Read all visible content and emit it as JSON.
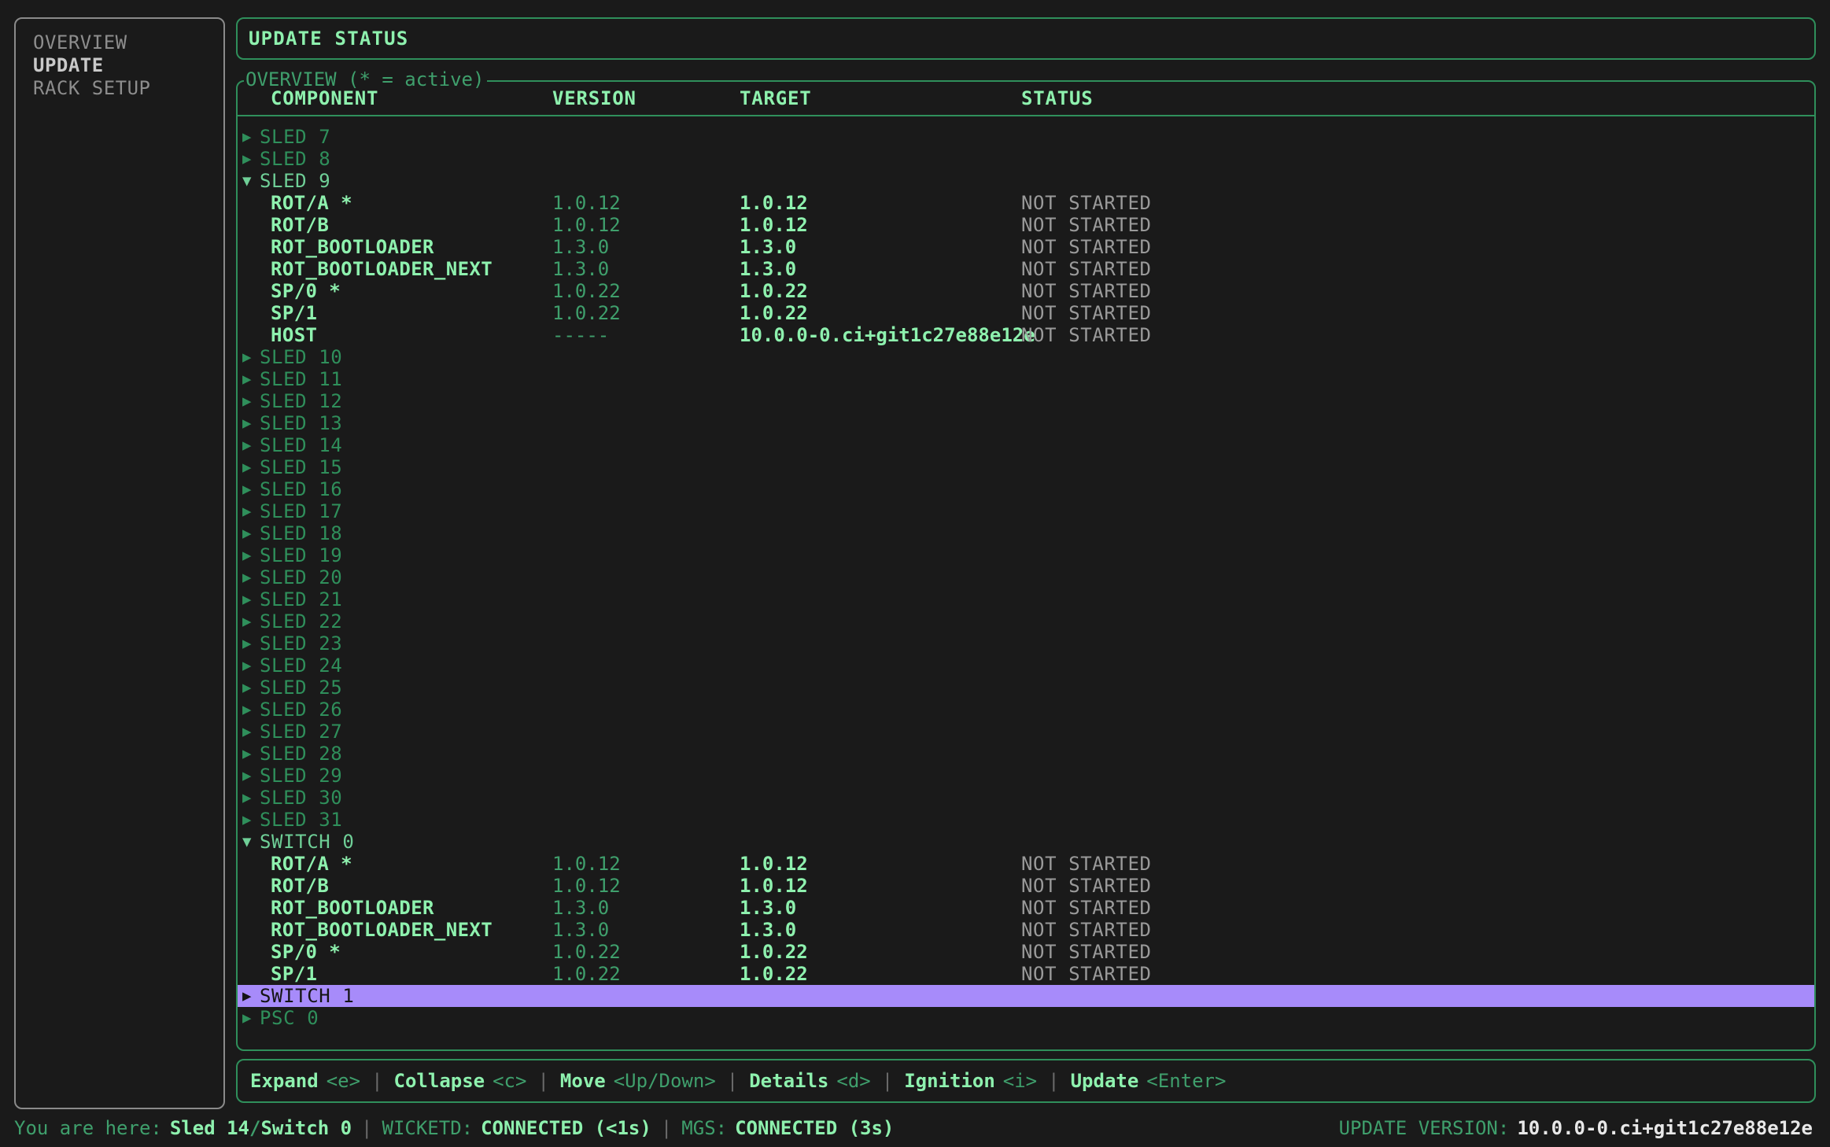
{
  "sidebar": {
    "items": [
      {
        "label": "OVERVIEW",
        "selected": false
      },
      {
        "label": "UPDATE",
        "selected": true
      },
      {
        "label": "RACK SETUP",
        "selected": false
      }
    ]
  },
  "header": {
    "title": "UPDATE STATUS"
  },
  "overview": {
    "legend": "OVERVIEW (* = active)",
    "columns": {
      "component": "COMPONENT",
      "version": "VERSION",
      "target": "TARGET",
      "status": "STATUS"
    },
    "rows": [
      {
        "kind": "group",
        "arrow": "▶",
        "label": "SLED 7",
        "expanded": false,
        "selected": false
      },
      {
        "kind": "group",
        "arrow": "▶",
        "label": "SLED 8",
        "expanded": false,
        "selected": false
      },
      {
        "kind": "group",
        "arrow": "▼",
        "label": "SLED 9",
        "expanded": true,
        "selected": false
      },
      {
        "kind": "comp",
        "component": "ROT/A *",
        "version": "1.0.12",
        "target": "1.0.12",
        "status": "NOT STARTED"
      },
      {
        "kind": "comp",
        "component": "ROT/B",
        "version": "1.0.12",
        "target": "1.0.12",
        "status": "NOT STARTED"
      },
      {
        "kind": "comp",
        "component": "ROT_BOOTLOADER",
        "version": "1.3.0",
        "target": "1.3.0",
        "status": "NOT STARTED"
      },
      {
        "kind": "comp",
        "component": "ROT_BOOTLOADER_NEXT",
        "version": "1.3.0",
        "target": "1.3.0",
        "status": "NOT STARTED"
      },
      {
        "kind": "comp",
        "component": "SP/0 *",
        "version": "1.0.22",
        "target": "1.0.22",
        "status": "NOT STARTED"
      },
      {
        "kind": "comp",
        "component": "SP/1",
        "version": "1.0.22",
        "target": "1.0.22",
        "status": "NOT STARTED"
      },
      {
        "kind": "comp",
        "component": "HOST",
        "version": "-----",
        "target": "10.0.0-0.ci+git1c27e88e12e",
        "status": "NOT STARTED",
        "target_long": true
      },
      {
        "kind": "group",
        "arrow": "▶",
        "label": "SLED 10",
        "expanded": false,
        "selected": false
      },
      {
        "kind": "group",
        "arrow": "▶",
        "label": "SLED 11",
        "expanded": false,
        "selected": false
      },
      {
        "kind": "group",
        "arrow": "▶",
        "label": "SLED 12",
        "expanded": false,
        "selected": false
      },
      {
        "kind": "group",
        "arrow": "▶",
        "label": "SLED 13",
        "expanded": false,
        "selected": false
      },
      {
        "kind": "group",
        "arrow": "▶",
        "label": "SLED 14",
        "expanded": false,
        "selected": false
      },
      {
        "kind": "group",
        "arrow": "▶",
        "label": "SLED 15",
        "expanded": false,
        "selected": false
      },
      {
        "kind": "group",
        "arrow": "▶",
        "label": "SLED 16",
        "expanded": false,
        "selected": false
      },
      {
        "kind": "group",
        "arrow": "▶",
        "label": "SLED 17",
        "expanded": false,
        "selected": false
      },
      {
        "kind": "group",
        "arrow": "▶",
        "label": "SLED 18",
        "expanded": false,
        "selected": false
      },
      {
        "kind": "group",
        "arrow": "▶",
        "label": "SLED 19",
        "expanded": false,
        "selected": false
      },
      {
        "kind": "group",
        "arrow": "▶",
        "label": "SLED 20",
        "expanded": false,
        "selected": false
      },
      {
        "kind": "group",
        "arrow": "▶",
        "label": "SLED 21",
        "expanded": false,
        "selected": false
      },
      {
        "kind": "group",
        "arrow": "▶",
        "label": "SLED 22",
        "expanded": false,
        "selected": false
      },
      {
        "kind": "group",
        "arrow": "▶",
        "label": "SLED 23",
        "expanded": false,
        "selected": false
      },
      {
        "kind": "group",
        "arrow": "▶",
        "label": "SLED 24",
        "expanded": false,
        "selected": false
      },
      {
        "kind": "group",
        "arrow": "▶",
        "label": "SLED 25",
        "expanded": false,
        "selected": false
      },
      {
        "kind": "group",
        "arrow": "▶",
        "label": "SLED 26",
        "expanded": false,
        "selected": false
      },
      {
        "kind": "group",
        "arrow": "▶",
        "label": "SLED 27",
        "expanded": false,
        "selected": false
      },
      {
        "kind": "group",
        "arrow": "▶",
        "label": "SLED 28",
        "expanded": false,
        "selected": false
      },
      {
        "kind": "group",
        "arrow": "▶",
        "label": "SLED 29",
        "expanded": false,
        "selected": false
      },
      {
        "kind": "group",
        "arrow": "▶",
        "label": "SLED 30",
        "expanded": false,
        "selected": false
      },
      {
        "kind": "group",
        "arrow": "▶",
        "label": "SLED 31",
        "expanded": false,
        "selected": false
      },
      {
        "kind": "group",
        "arrow": "▼",
        "label": "SWITCH 0",
        "expanded": true,
        "selected": false
      },
      {
        "kind": "comp",
        "component": "ROT/A *",
        "version": "1.0.12",
        "target": "1.0.12",
        "status": "NOT STARTED"
      },
      {
        "kind": "comp",
        "component": "ROT/B",
        "version": "1.0.12",
        "target": "1.0.12",
        "status": "NOT STARTED"
      },
      {
        "kind": "comp",
        "component": "ROT_BOOTLOADER",
        "version": "1.3.0",
        "target": "1.3.0",
        "status": "NOT STARTED"
      },
      {
        "kind": "comp",
        "component": "ROT_BOOTLOADER_NEXT",
        "version": "1.3.0",
        "target": "1.3.0",
        "status": "NOT STARTED"
      },
      {
        "kind": "comp",
        "component": "SP/0 *",
        "version": "1.0.22",
        "target": "1.0.22",
        "status": "NOT STARTED"
      },
      {
        "kind": "comp",
        "component": "SP/1",
        "version": "1.0.22",
        "target": "1.0.22",
        "status": "NOT STARTED"
      },
      {
        "kind": "group",
        "arrow": "▶",
        "label": "SWITCH 1",
        "expanded": false,
        "selected": true
      },
      {
        "kind": "group",
        "arrow": "▶",
        "label": "PSC 0",
        "expanded": false,
        "selected": false
      }
    ]
  },
  "help": {
    "items": [
      {
        "label": "Expand",
        "key": "<e>"
      },
      {
        "label": "Collapse",
        "key": "<c>"
      },
      {
        "label": "Move",
        "key": "<Up/Down>"
      },
      {
        "label": "Details",
        "key": "<d>"
      },
      {
        "label": "Ignition",
        "key": "<i>"
      },
      {
        "label": "Update",
        "key": "<Enter>"
      }
    ],
    "separator": "|"
  },
  "statusbar": {
    "you_are_here_label": "You are here:",
    "location_primary": "Sled 14",
    "location_separator": "/",
    "location_secondary": "Switch 0",
    "separator": "|",
    "wicketd_label": "WICKETD:",
    "wicketd_value": "CONNECTED (<1s)",
    "mgs_label": "MGS:",
    "mgs_value": "CONNECTED (3s)",
    "update_version_label": "UPDATE VERSION:",
    "update_version_value": "10.0.0-0.ci+git1c27e88e12e"
  }
}
